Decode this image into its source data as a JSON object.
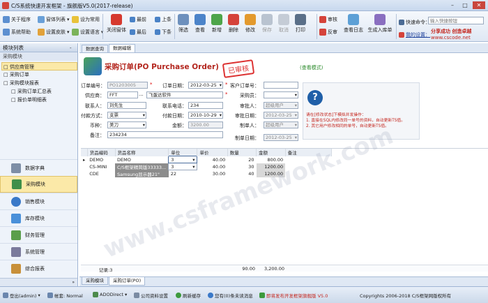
{
  "window": {
    "title": "C/S系统快速开发框架 - 旗舰版V5.0(2017-release)"
  },
  "toolbar": {
    "small": [
      {
        "label": "关于程序",
        "icon": "info-icon"
      },
      {
        "label": "窗体列表",
        "icon": "window-list-icon"
      },
      {
        "label": "设为常用",
        "icon": "star-icon"
      },
      {
        "label": "系统帮助",
        "icon": "help-icon"
      },
      {
        "label": "设置皮肤",
        "icon": "skin-icon"
      },
      {
        "label": "设置语言",
        "icon": "language-icon"
      }
    ],
    "close_label": "关闭窗体",
    "nav": [
      {
        "label": "最前"
      },
      {
        "label": "上条"
      },
      {
        "label": "最后"
      },
      {
        "label": "下条"
      }
    ],
    "big": [
      {
        "label": "筛选"
      },
      {
        "label": "查看"
      },
      {
        "label": "新增"
      },
      {
        "label": "删除"
      },
      {
        "label": "修改"
      },
      {
        "label": "保存"
      },
      {
        "label": "取消"
      },
      {
        "label": "打印"
      }
    ],
    "audit": [
      {
        "label": "审核"
      },
      {
        "label": "反审"
      }
    ],
    "log_label": "查看日志",
    "gen_label": "生成入库单",
    "cmd_label": "快速命令：",
    "cmd_placeholder": "输入快捷按钮",
    "mysettings_label": "我的设置：",
    "promo1": "分享成功 创造卓越",
    "promo2": "www.cscode.net"
  },
  "left": {
    "header": "模块列表",
    "section": "采购模块",
    "tree": [
      "供应商管理",
      "采购订单",
      "采购模块报表",
      "采购订单汇总表",
      "报价单明细表"
    ],
    "nav": [
      "数据字典",
      "采购模块",
      "销售模块",
      "库存模块",
      "财务管理",
      "系统管理",
      "综合报表"
    ]
  },
  "tabs": [
    "数据查询",
    "数据编辑"
  ],
  "form": {
    "title": "采购订单(PO Purchase Order)",
    "stamp": "已审核",
    "mode": "(查看模式)",
    "fields": [
      {
        "label": "订单编号：",
        "value": "PO1203005"
      },
      {
        "label": "订单日期：",
        "value": "2012-03-25"
      },
      {
        "label": "客户订单号：",
        "value": ""
      },
      {
        "label": "供应商：",
        "value": "FFT",
        "extra": "飞蛋达软件"
      },
      {
        "label": "采购员：",
        "value": ""
      },
      {
        "label": "联系人：",
        "value": "刘先生"
      },
      {
        "label": "联系电话：",
        "value": "234"
      },
      {
        "label": "审批人：",
        "value": "超级用户"
      },
      {
        "label": "付款方式：",
        "value": "支票"
      },
      {
        "label": "付款日期：",
        "value": "2010-10-29"
      },
      {
        "label": "审批日期：",
        "value": "2012-03-25"
      },
      {
        "label": "币种：",
        "value": "美刀"
      },
      {
        "label": "金额：",
        "value": "3200.00"
      },
      {
        "label": "制单人：",
        "value": "超级用户"
      },
      {
        "label": "备注：",
        "value": "234234"
      },
      {
        "label": "制单日期：",
        "value": "2012-03-25"
      }
    ],
    "hint": [
      "请在[修改状态]下模拟并发操作：",
      "1. 直接在SQL内修改同一单号的资料，自动更新TS值。",
      "2. 其它用户修改相同的单号，自动更新TS值。"
    ]
  },
  "grid": {
    "columns": [
      "货品编码",
      "货品名称",
      "单位",
      "单价",
      "数量",
      "金额",
      "备注"
    ],
    "rows": [
      {
        "code": "DEMO",
        "name": "DEMO",
        "unit": "3",
        "price": "40.00",
        "qty": "20",
        "amount": "800.00",
        "note": ""
      },
      {
        "code": "CS-MINI",
        "name": "C/S框架精简版33333...",
        "unit": "3",
        "price": "40.00",
        "qty": "30",
        "amount": "1200.00",
        "note": ""
      },
      {
        "code": "CDE",
        "name": "Samsung显示器21\"",
        "unit": "22",
        "price": "30.00",
        "qty": "40",
        "amount": "1200.00",
        "note": ""
      }
    ],
    "footer": {
      "count": "记录:3",
      "qty_total": "90.00",
      "amount_total": "3,200.00"
    }
  },
  "bottom_tabs": [
    "采购模块",
    "采购订单(PO)"
  ],
  "watermark": "www.csframework.com",
  "status": [
    "登出(admin)",
    "帐套: Normal",
    "ADODirect",
    "公司资料设置",
    "刷新缓存",
    "您有(0)条未读消息",
    "即将发布开发框架旗舰版 V5.0",
    "Copyrights 2006-2018 C/S框架网版权所有"
  ]
}
